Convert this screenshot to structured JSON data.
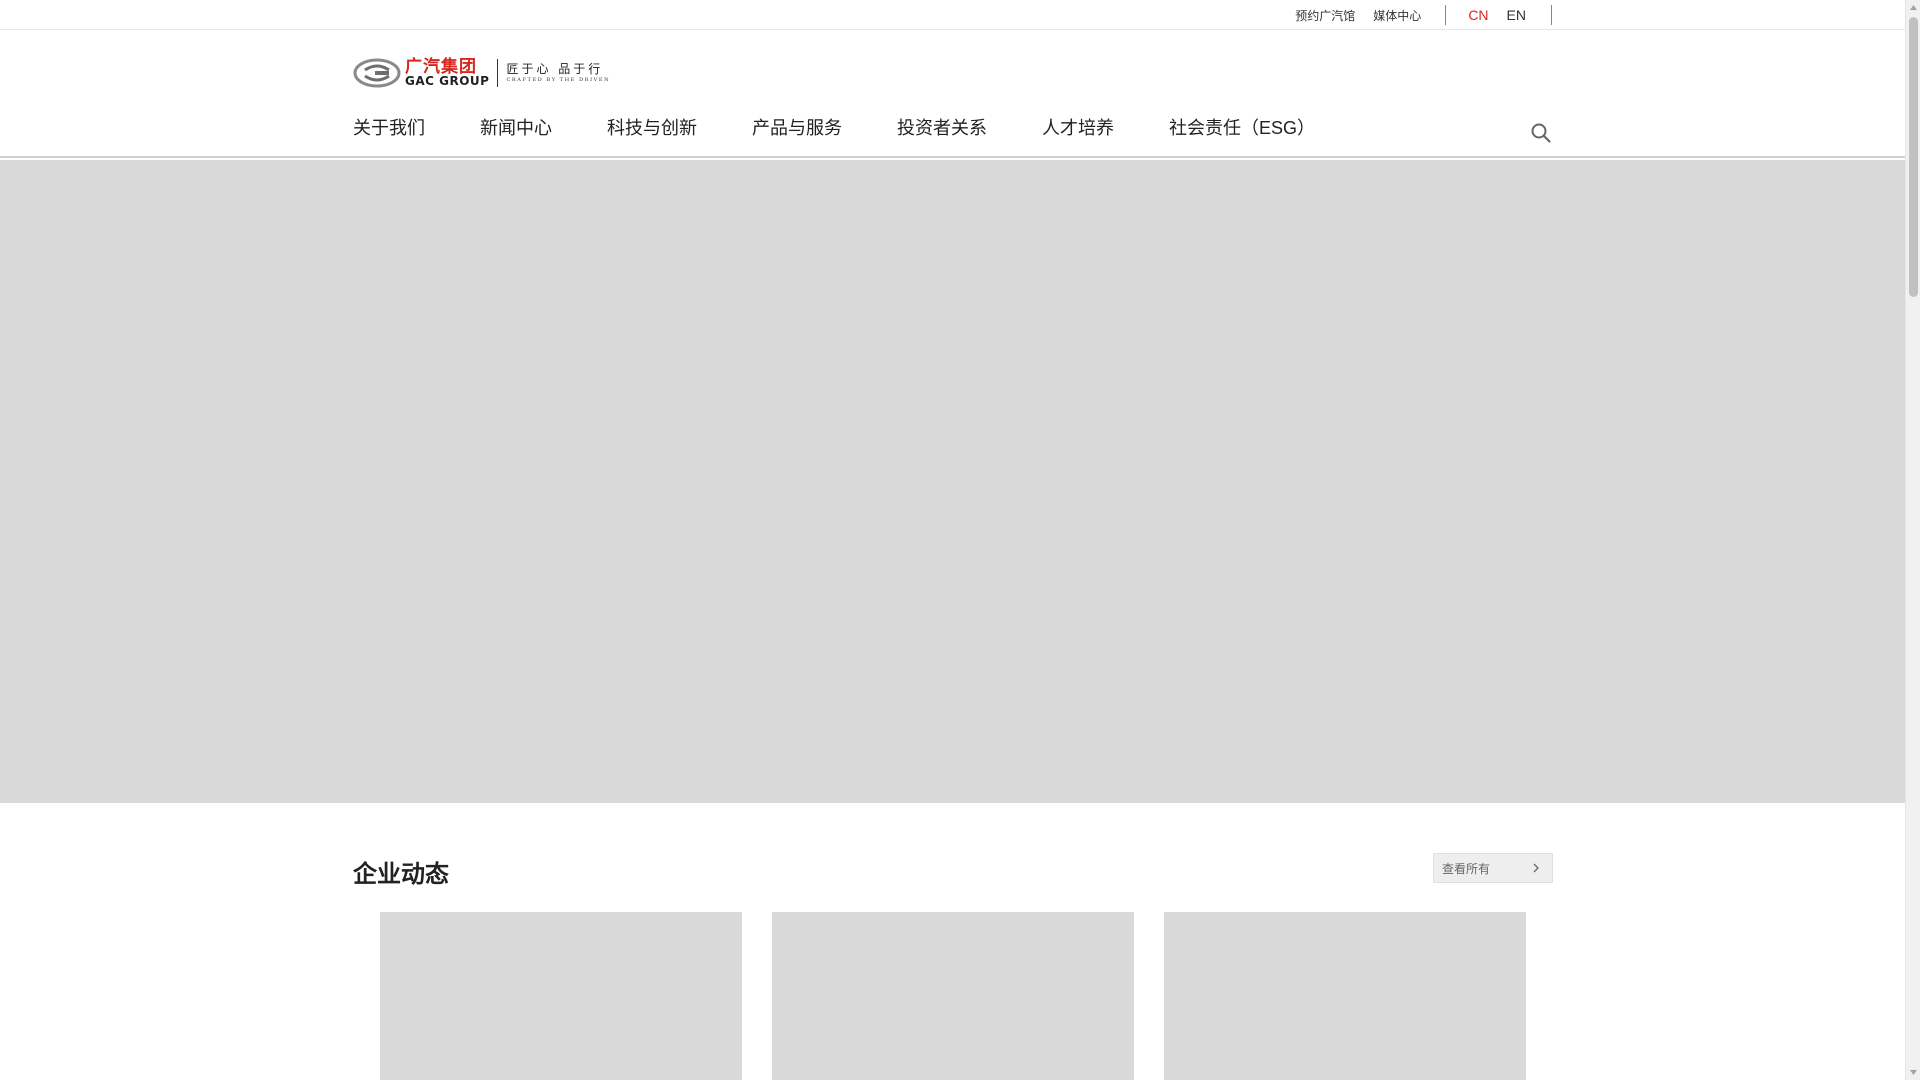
{
  "topbar": {
    "links": [
      "预约广汽馆",
      "媒体中心"
    ],
    "languages": [
      {
        "label": "CN",
        "active": true
      },
      {
        "label": "EN",
        "active": false
      }
    ]
  },
  "brand": {
    "name_cn": "广汽集团",
    "name_en": "GAC GROUP",
    "slogan_cn": "匠于心 品于行",
    "slogan_en": "CRAFTED BY THE DRIVEN",
    "accent_color": "#d7261e"
  },
  "nav": {
    "items": [
      "关于我们",
      "新闻中心",
      "科技与创新",
      "产品与服务",
      "投资者关系",
      "人才培养",
      "社会责任（ESG）"
    ],
    "search_icon": "search-icon"
  },
  "news": {
    "title": "企业动态",
    "view_all": "查看所有"
  }
}
